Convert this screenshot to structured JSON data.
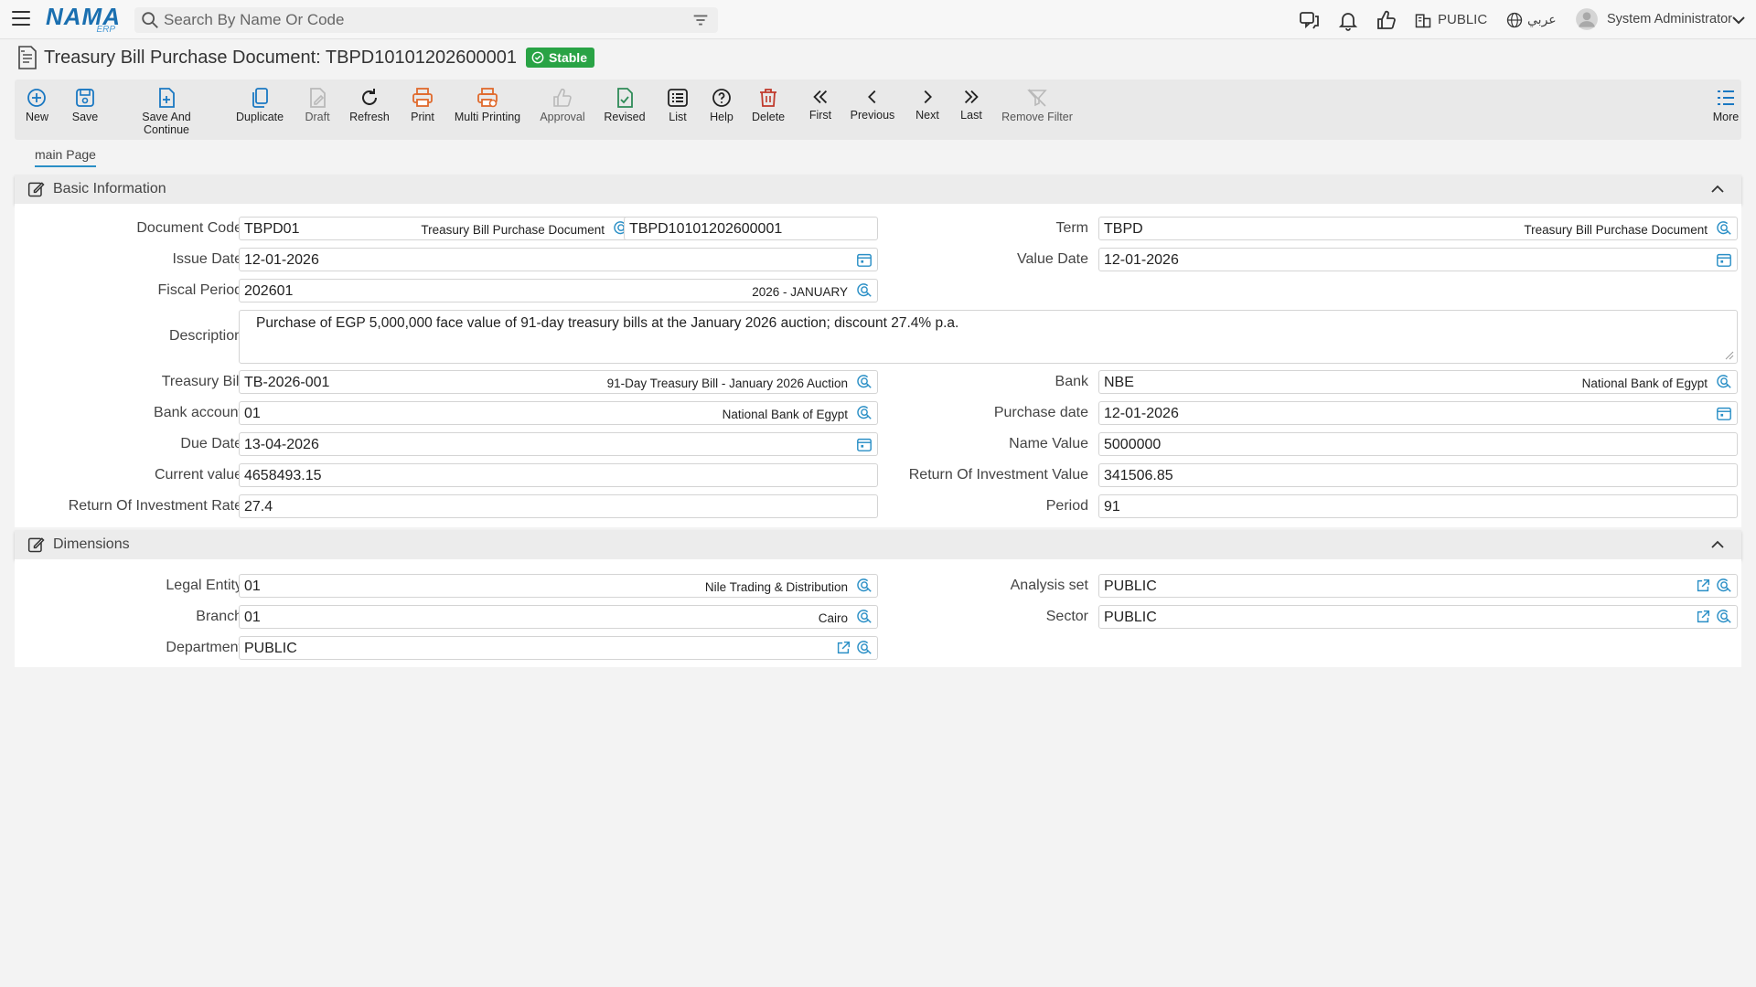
{
  "app": {
    "logo_text": "NAMA",
    "logo_sub": "ERP",
    "search_placeholder": "Search By Name Or Code",
    "public_label": "PUBLIC",
    "language_label": "عربي",
    "user_name": "System Administrator"
  },
  "page": {
    "title": "Treasury Bill Purchase Document: TBPD10101202600001",
    "status": "Stable"
  },
  "toolbar": {
    "new": "New",
    "save": "Save",
    "save_continue": "Save And Continue",
    "duplicate": "Duplicate",
    "draft": "Draft",
    "refresh": "Refresh",
    "print": "Print",
    "multi_printing": "Multi Printing",
    "approval": "Approval",
    "revised": "Revised",
    "list": "List",
    "help": "Help",
    "delete": "Delete",
    "first": "First",
    "previous": "Previous",
    "next": "Next",
    "last": "Last",
    "remove_filter": "Remove Filter",
    "more": "More"
  },
  "tabs": {
    "main": "main Page"
  },
  "basic": {
    "title": "Basic Information",
    "document_code": {
      "label": "Document Code",
      "code": "TBPD01",
      "name": "Treasury Bill Purchase Document",
      "number": "TBPD10101202600001"
    },
    "term": {
      "label": "Term",
      "code": "TBPD",
      "name": "Treasury Bill Purchase Document"
    },
    "issue_date": {
      "label": "Issue Date",
      "value": "12-01-2026"
    },
    "value_date": {
      "label": "Value Date",
      "value": "12-01-2026"
    },
    "fiscal_period": {
      "label": "Fiscal Period",
      "code": "202601",
      "name": "2026 - JANUARY"
    },
    "description": {
      "label": "Description",
      "value": "Purchase of EGP 5,000,000 face value of 91-day treasury bills at the January 2026 auction; discount 27.4% p.a."
    },
    "treasury_bill": {
      "label": "Treasury Bill",
      "code": "TB-2026-001",
      "name": "91-Day Treasury Bill - January 2026 Auction"
    },
    "bank": {
      "label": "Bank",
      "code": "NBE",
      "name": "National Bank of Egypt"
    },
    "bank_account": {
      "label": "Bank account",
      "code": "01",
      "name": "National Bank of Egypt"
    },
    "purchase_date": {
      "label": "Purchase date",
      "value": "12-01-2026"
    },
    "due_date": {
      "label": "Due Date",
      "value": "13-04-2026"
    },
    "name_value": {
      "label": "Name Value",
      "value": "5000000"
    },
    "current_value": {
      "label": "Current value",
      "value": "4658493.15"
    },
    "roi_value": {
      "label": "Return Of Investment Value",
      "value": "341506.85"
    },
    "roi_rate": {
      "label": "Return Of Investment Rate",
      "value": "27.4"
    },
    "period": {
      "label": "Period",
      "value": "91"
    }
  },
  "dimensions": {
    "title": "Dimensions",
    "legal_entity": {
      "label": "Legal Entity",
      "code": "01",
      "name": "Nile Trading & Distribution"
    },
    "analysis_set": {
      "label": "Analysis set",
      "value": "PUBLIC"
    },
    "branch": {
      "label": "Branch",
      "code": "01",
      "name": "Cairo"
    },
    "sector": {
      "label": "Sector",
      "value": "PUBLIC"
    },
    "department": {
      "label": "Department",
      "value": "PUBLIC"
    }
  },
  "colors": {
    "accent": "#2a8fc6",
    "badge": "#29a345",
    "icon_blue": "#1a78c2",
    "icon_orange": "#e06a2c",
    "icon_red": "#c0392b",
    "icon_green": "#2e8b57"
  },
  "icons": [
    "menu-icon",
    "search-icon",
    "filter-icon",
    "chat-icon",
    "bell-icon",
    "thumbs-up-icon",
    "building-icon",
    "globe-icon",
    "avatar-icon",
    "chevron-down-icon",
    "search-lookup-icon",
    "calendar-icon",
    "external-link-icon",
    "edit-icon",
    "chevron-up-icon"
  ]
}
